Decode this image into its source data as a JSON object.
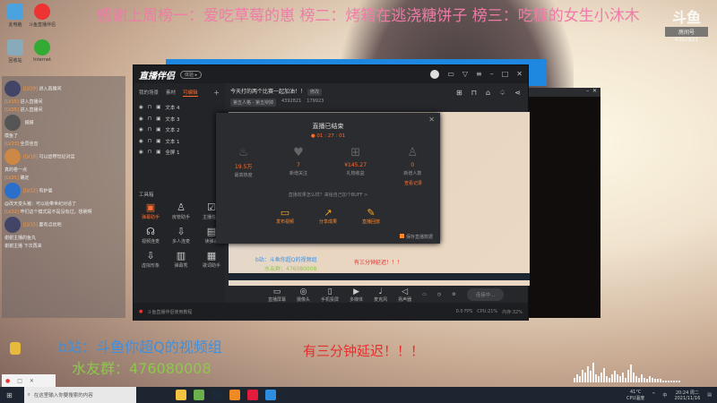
{
  "banner": "感谢上周榜一：爱吃草莓的崽 榜二：烤箱在逃浇糖饼子 榜三：吃糠的女生小沐木",
  "douyu": {
    "logo": "斗鱼",
    "label": "房间号",
    "room": "4392821"
  },
  "desktop": [
    {
      "label": "此电脑",
      "color": "#4aa3df"
    },
    {
      "label": "斗鱼直播伴侣",
      "color": "#e33"
    },
    {
      "label": "回收站",
      "color": "#8ab"
    },
    {
      "label": "Internet",
      "color": "#3a3"
    }
  ],
  "app": {
    "logo": "直播伴侣",
    "badge": "体验 ▸",
    "tabs": [
      "我的场景",
      "素材",
      "可编辑"
    ],
    "scenes": [
      "文本 4",
      "文本 3",
      "文本 2",
      "文本 1",
      "全屏 1"
    ],
    "toolbox_title": "工具箱",
    "tools": [
      {
        "label": "弹幕助手",
        "icon": "▣"
      },
      {
        "label": "房管助手",
        "icon": "♙"
      },
      {
        "label": "主播任务",
        "icon": "☑"
      },
      {
        "label": "视频连麦",
        "icon": "☊"
      },
      {
        "label": "多人连麦",
        "icon": "⇩"
      },
      {
        "label": "读弹幕",
        "icon": "▤"
      },
      {
        "label": "虚拟形象",
        "icon": "⇩"
      },
      {
        "label": "弹幕秀",
        "icon": "▥"
      },
      {
        "label": "歌词助手",
        "icon": "▦"
      }
    ],
    "tutorial": "斗鱼直播伴侣使用教程",
    "room_title": "今天打的两个比赛一起加油！！",
    "edit": "修改",
    "category": "第五人格 - 第五辩掉",
    "room_id": "4392821",
    "heat": "179923",
    "modal": {
      "title": "直播已结束",
      "duration": "01 : 27 : 01",
      "stats": [
        {
          "value": "19.5万",
          "label": "最高热度",
          "icon": "flame"
        },
        {
          "value": "7",
          "label": "新增关注",
          "icon": "heart"
        },
        {
          "value": "¥145.27",
          "label": "礼物收益",
          "icon": "gift"
        },
        {
          "value": "0",
          "label": "新增人数",
          "icon": "user"
        }
      ],
      "view_record": "查看记录",
      "buff": "直播效果怎么样？来给自己加个BUFF >",
      "actions": [
        {
          "label": "发布视频",
          "icon": "▭"
        },
        {
          "label": "分享成果",
          "icon": "↗"
        },
        {
          "label": "直播回放",
          "icon": "✎"
        }
      ],
      "save": "保存直播数据"
    },
    "controls": [
      {
        "label": "直播屏幕",
        "icon": "▭"
      },
      {
        "label": "摄像头",
        "icon": "◎"
      },
      {
        "label": "手机投屏",
        "icon": "▯"
      },
      {
        "label": "多媒体",
        "icon": "▶"
      },
      {
        "label": "麦克风",
        "icon": "♩"
      },
      {
        "label": "扬声器",
        "icon": "◁"
      }
    ],
    "connect": "连接中...",
    "status": [
      "CPU:21%",
      "内存:32%",
      "0.0 FPS"
    ]
  },
  "chat": [
    {
      "user": "[LV29]",
      "text": "进入直播间"
    },
    {
      "user": "[LV15]",
      "text": "进入直播间"
    },
    {
      "user": "[LV25]",
      "text": "进入直播间"
    },
    {
      "user": "",
      "text": "摸摸"
    },
    {
      "user": "",
      "text": "摸鱼了"
    },
    {
      "user": "[LV23]",
      "text": "全员佳音"
    },
    {
      "user": "[LV18]",
      "text": "可以给带世纪对话"
    },
    {
      "user": "",
      "text": "真的卷一点"
    },
    {
      "user": "[LV25]",
      "text": "确定"
    },
    {
      "user": "[LV12]",
      "text": "有护盾"
    },
    {
      "user": "",
      "text": "@改天变头猪：可以给带世纪对话了"
    },
    {
      "user": "[LV22]",
      "text": "咋们这个模式是不是没有过，想刷啊"
    },
    {
      "user": "[LV15]",
      "text": "要有点优吧"
    },
    {
      "user": "",
      "text": "谢谢主播的鱼丸"
    },
    {
      "user": "",
      "text": "谢谢主播 下次再来"
    }
  ],
  "overlay": {
    "bili": "b站：斗鱼你超Q的视频组",
    "qq": "水友群：476080008",
    "delay": "有三分钟延迟！！！"
  },
  "visualizer": [
    3,
    5,
    4,
    8,
    6,
    10,
    7,
    12,
    5,
    4,
    6,
    9,
    4,
    3,
    5,
    7,
    5,
    4,
    6,
    3,
    8,
    11,
    6,
    4,
    3,
    5,
    3,
    2,
    4,
    3,
    2,
    2,
    2,
    1,
    1,
    1,
    1,
    1,
    1,
    1
  ],
  "taskbar": {
    "search": "在这里输入你要搜索的内容",
    "apps": [
      "#f5c242",
      "#6ab04c",
      "#1b2838",
      "#f08a24",
      "#e31c3d",
      "#2d8ee0"
    ],
    "temp": "41°C",
    "temp_label": "CPU温度",
    "ime": "中",
    "time": "20:24 周二",
    "date": "2021/11/16"
  }
}
